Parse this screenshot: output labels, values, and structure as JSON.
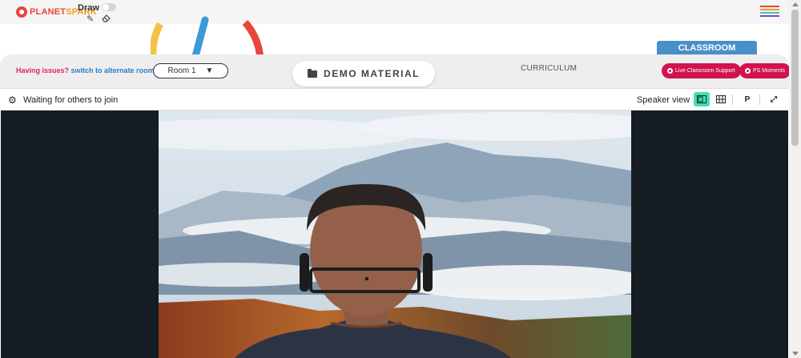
{
  "app": {
    "logo": {
      "text_part1": "PLANET",
      "text_part2": "SPARK"
    },
    "draw": {
      "label": "Draw",
      "enabled": false,
      "tools": [
        "pencil-icon",
        "eraser-icon"
      ]
    },
    "menu_icon": "hamburger-icon",
    "menu_colors": [
      "#e8453c",
      "#f39c12",
      "#3ec1d3",
      "#8e44ad"
    ]
  },
  "room_bar": {
    "issues_text": "Having issues?",
    "switch_link": "switch to alternate room",
    "room_selected": "Room 1",
    "demo_material": "DEMO MATERIAL",
    "curriculum": "CURRICULUM",
    "classroom_tab": "CLASSROOM",
    "live_support": "Live Classroom Support",
    "ps_moments": "PS Moments"
  },
  "call": {
    "status": "Waiting for others to join",
    "view_label": "Speaker view",
    "view_buttons": [
      "speaker-view-icon",
      "grid-view-icon"
    ],
    "p_button": "P",
    "fullscreen_icon": "expand-icon"
  },
  "colors": {
    "accent_red": "#d0134f",
    "accent_blue": "#4a90c8",
    "active_view": "#3fe0b5",
    "video_bg": "#151c22"
  }
}
